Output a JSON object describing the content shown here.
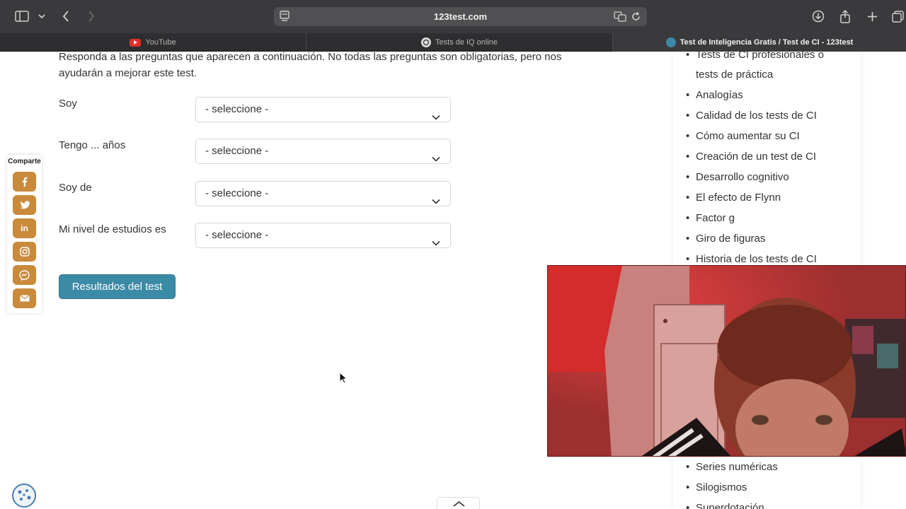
{
  "browser": {
    "url": "123test.com",
    "tabs": [
      {
        "label": "YouTube"
      },
      {
        "label": "Tests de IQ online"
      },
      {
        "label": "Test de Inteligencia Gratis / Test de CI - 123test"
      }
    ]
  },
  "form": {
    "intro": "Responda a las preguntas que aparecen a continuación. No todas las preguntas son obligatorias, pero nos ayudarán a mejorar este test.",
    "questions": [
      {
        "label": "Soy",
        "value": "- seleccione -"
      },
      {
        "label": "Tengo ... años",
        "value": "- seleccione -"
      },
      {
        "label": "Soy de",
        "value": "- seleccione -"
      },
      {
        "label": "Mi nivel de estudios es",
        "value": "- seleccione -"
      }
    ],
    "submit_label": "Resultados del test"
  },
  "share": {
    "title": "Comparte",
    "buttons": [
      "facebook-icon",
      "twitter-icon",
      "linkedin-icon",
      "instagram-icon",
      "messenger-icon",
      "email-icon"
    ]
  },
  "sidebar": {
    "items": [
      "Tests de CI profesionales o",
      "tests de práctica",
      "Analogías",
      "Calidad de los tests de CI",
      "Cómo aumentar su CI",
      "Creación de un test de CI",
      "Desarrollo cognitivo",
      "El efecto de Flynn",
      "Factor g",
      "Giro de figuras",
      "Historia de los tests de CI",
      "Series numéricas",
      "Silogismos",
      "Superdotación"
    ]
  },
  "colors": {
    "accent": "#3b8aa6",
    "share_button": "#c98a3b",
    "toolbar": "#3a3a3c"
  }
}
